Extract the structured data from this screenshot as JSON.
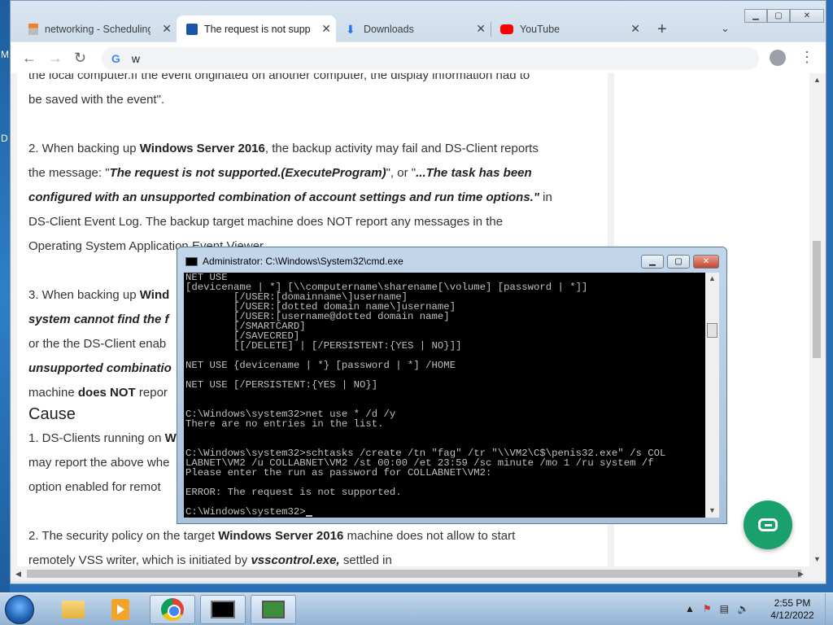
{
  "desktop": {
    "letters": [
      "M",
      "D"
    ]
  },
  "browser": {
    "tabs": [
      {
        "title": "networking - Scheduling",
        "favicon": "stackexchange-icon",
        "active": false
      },
      {
        "title": "The request is not supported",
        "favicon": "document-icon",
        "active": true
      },
      {
        "title": "Downloads",
        "favicon": "download-icon",
        "active": false
      },
      {
        "title": "YouTube",
        "favicon": "youtube-icon",
        "active": false
      }
    ],
    "omnibox_text": "w",
    "article": {
      "p1_line1": "the local computer.If the event originated on another computer, the display information had to",
      "p1_line2": "be saved with the event\".",
      "p2_a": "2. When backing up ",
      "p2_b": "Windows Server 2016",
      "p2_c": ", the backup activity may fail and DS-Client reports",
      "p2_d": "the message: \"",
      "p2_e": "The request is not supported.(ExecuteProgram)",
      "p2_f": "\", or  \"",
      "p2_g": "...The task has been",
      "p2_h": "configured with an unsupported combination of account settings and run time options.\"",
      "p2_i": " in",
      "p2_j": "DS-Client Event Log. The backup target machine does NOT report any messages in the",
      "p2_k": "Operating System Application Event Viewer.",
      "p3_a": "3. When backing up ",
      "p3_b": "Wind",
      "p3_c": "system cannot find the f",
      "p3_d": "or the the DS-Client enab",
      "p3_e": "unsupported combinatio",
      "p3_f": "machine ",
      "p3_g": "does NOT",
      "p3_h": " repor",
      "cause_heading": "Cause",
      "c1_a": "1. DS-Clients running on ",
      "c1_b": "W",
      "c1_c": "may report the above whe",
      "c1_d": "option enabled for remot",
      "c2_a": "2. The security policy on the target ",
      "c2_b": "Windows Server 2016",
      "c2_c": " machine does not allow to start",
      "c2_d": "remotely VSS writer, which is initiated by ",
      "c2_e": "vsscontrol.exe,",
      "c2_f": " settled in"
    }
  },
  "cmd": {
    "title": "Administrator: C:\\Windows\\System32\\cmd.exe",
    "lines": [
      "NET USE",
      "[devicename | *] [\\\\computername\\sharename[\\volume] [password | *]]",
      "        [/USER:[domainname\\]username]",
      "        [/USER:[dotted domain name\\]username]",
      "        [/USER:[username@dotted domain name]",
      "        [/SMARTCARD]",
      "        [/SAVECRED]",
      "        [[/DELETE] | [/PERSISTENT:{YES | NO}]]",
      "",
      "NET USE {devicename | *} [password | *] /HOME",
      "",
      "NET USE [/PERSISTENT:{YES | NO}]",
      "",
      "",
      "C:\\Windows\\system32>net use * /d /y",
      "There are no entries in the list.",
      "",
      "",
      "C:\\Windows\\system32>schtasks /create /tn \"fag\" /tr \"\\\\VM2\\C$\\penis32.exe\" /s COL",
      "LABNET\\VM2 /u COLLABNET\\VM2 /st 00:00 /et 23:59 /sc minute /mo 1 /ru system /f",
      "Please enter the run as password for COLLABNET\\VM2:",
      "",
      "ERROR: The request is not supported.",
      "",
      "C:\\Windows\\system32>"
    ]
  },
  "taskbar": {
    "time": "2:55 PM",
    "date": "4/12/2022"
  },
  "colors": {
    "chat_fab": "#1aa06d",
    "desktop": "#2a6fb5"
  }
}
